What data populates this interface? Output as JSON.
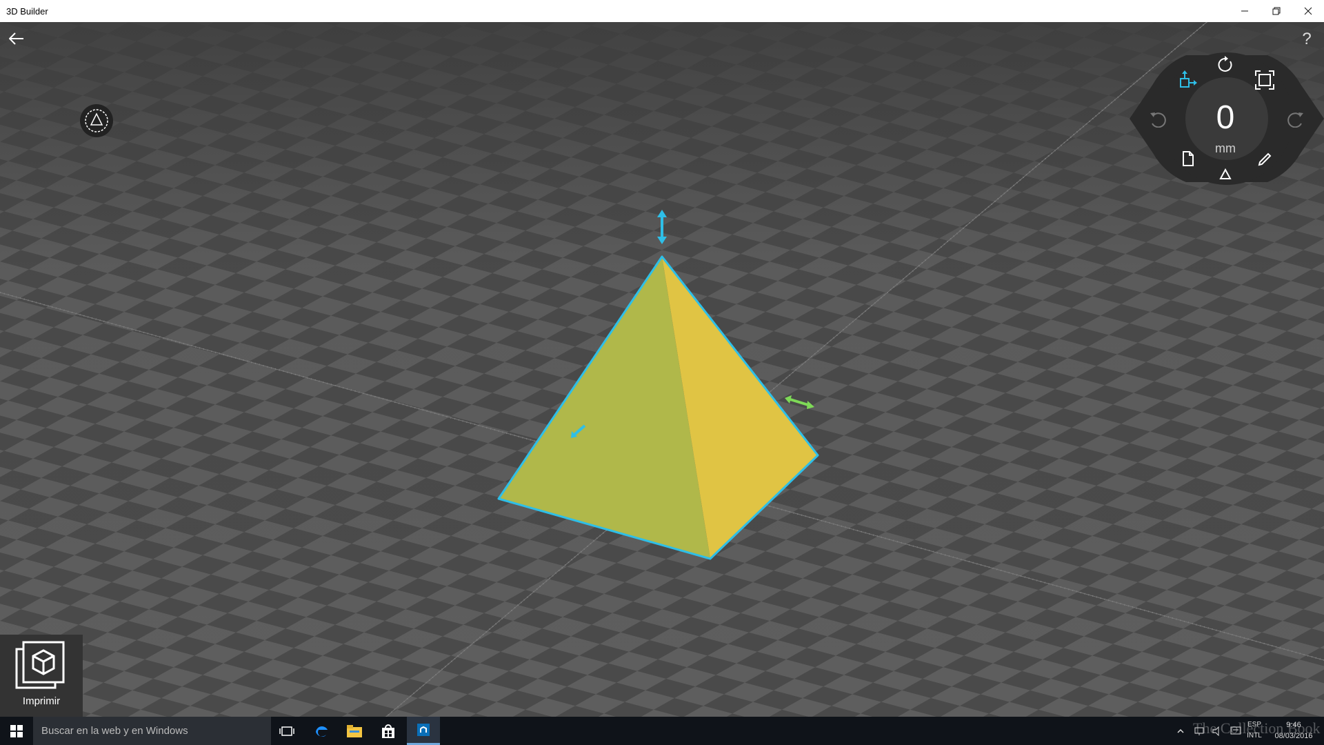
{
  "window": {
    "title": "3D Builder"
  },
  "toolbar": {
    "help_label": "?"
  },
  "dial": {
    "value": "0",
    "unit": "mm"
  },
  "print_button": {
    "label": "Imprimir"
  },
  "taskbar": {
    "search_placeholder": "Buscar en la web y en Windows",
    "tray": {
      "language": "ESP",
      "layout": "INTL",
      "time": "9:46",
      "date": "08/03/2016"
    }
  },
  "watermark": {
    "text": "The Collection Book"
  },
  "colors": {
    "pyramid_left_face": "#b0b84a",
    "pyramid_right_face": "#e0c444",
    "selection_outline": "#2ebfe8",
    "move_handle_green": "#7ed957",
    "floor_dark": "#4a4a4a",
    "floor_light": "#5e5e5e"
  }
}
